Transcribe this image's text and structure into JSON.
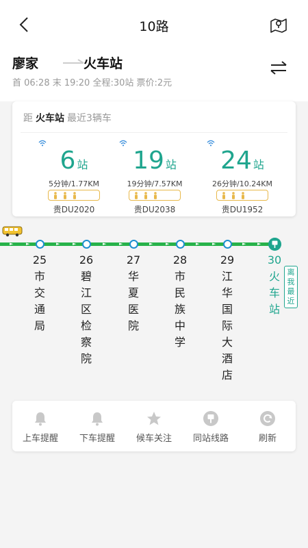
{
  "nav": {
    "title": "10路"
  },
  "route": {
    "from": "廖家",
    "to": "火车站",
    "info": "首 06:28 末 19:20 全程:30站  票价:2元"
  },
  "realtime": {
    "prefix": "距",
    "station": "火车站",
    "suffix": "最近3辆车",
    "buses": [
      {
        "stops": "6",
        "unit": "站",
        "dist": "5分钟/1.77KM",
        "plate": "贵DU2020"
      },
      {
        "stops": "19",
        "unit": "站",
        "dist": "19分钟/7.57KM",
        "plate": "贵DU2038"
      },
      {
        "stops": "24",
        "unit": "站",
        "dist": "26分钟/10.24KM",
        "plate": "贵DU1952"
      }
    ]
  },
  "stations": [
    {
      "num": "25",
      "name": "市交通局"
    },
    {
      "num": "26",
      "name": "碧江区检察院"
    },
    {
      "num": "27",
      "name": "华夏医院"
    },
    {
      "num": "28",
      "name": "市民族中学"
    },
    {
      "num": "29",
      "name": "江华国际大酒店"
    },
    {
      "num": "30",
      "name": "火车站"
    }
  ],
  "near_tag": "离我最近",
  "tools": [
    {
      "label": "上车提醒",
      "icon": "bell-icon"
    },
    {
      "label": "下车提醒",
      "icon": "bell-icon"
    },
    {
      "label": "候车关注",
      "icon": "star-icon"
    },
    {
      "label": "同站线路",
      "icon": "bus-stop-icon"
    },
    {
      "label": "刷新",
      "icon": "refresh-icon"
    }
  ],
  "colors": {
    "accent": "#1fa58e",
    "track": "#27b24a",
    "stop_ring": "#1d8fcf",
    "crowd": "#e8b84a"
  }
}
